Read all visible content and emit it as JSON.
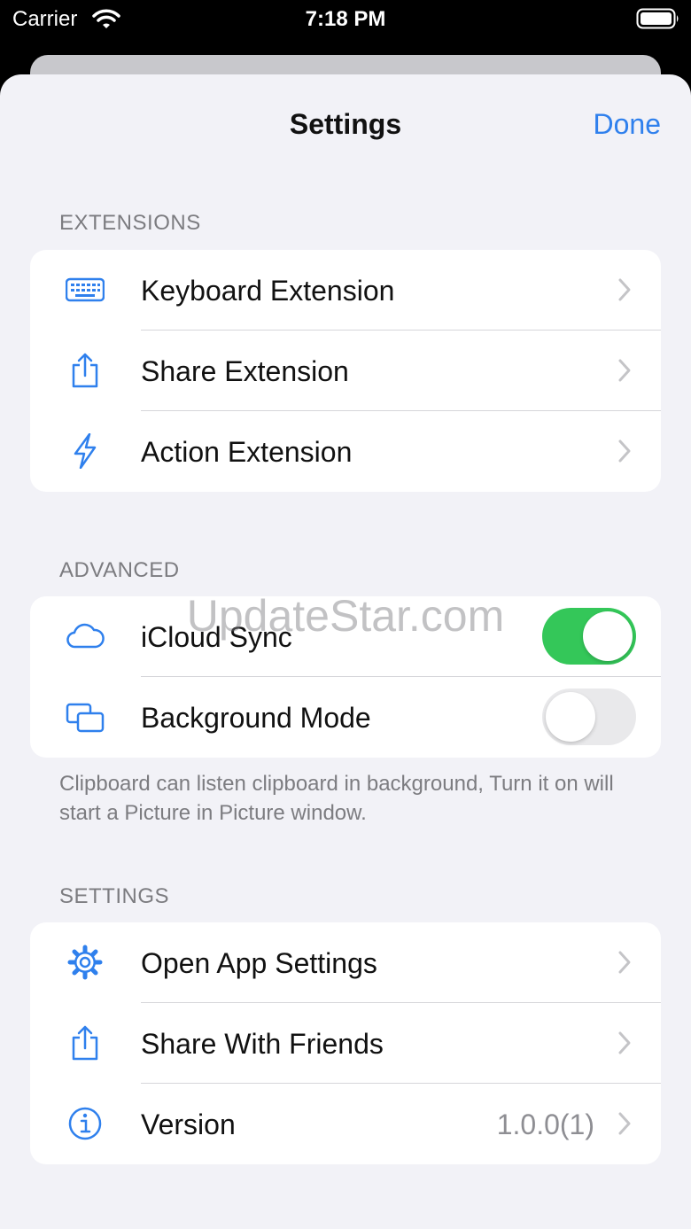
{
  "status_bar": {
    "carrier": "Carrier",
    "time": "7:18 PM"
  },
  "nav": {
    "title": "Settings",
    "done_label": "Done"
  },
  "sections": {
    "extensions": {
      "header": "EXTENSIONS",
      "items": [
        {
          "label": "Keyboard Extension",
          "icon": "keyboard-icon"
        },
        {
          "label": "Share Extension",
          "icon": "share-icon"
        },
        {
          "label": "Action Extension",
          "icon": "bolt-icon"
        }
      ]
    },
    "advanced": {
      "header": "ADVANCED",
      "items": [
        {
          "label": "iCloud Sync",
          "icon": "cloud-icon",
          "toggle": true
        },
        {
          "label": "Background Mode",
          "icon": "windows-icon",
          "toggle": false
        }
      ],
      "footer": "Clipboard can listen clipboard in background, Turn it on will start a Picture in Picture window."
    },
    "settings": {
      "header": "SETTINGS",
      "items": [
        {
          "label": "Open App Settings",
          "icon": "gear-icon"
        },
        {
          "label": "Share With Friends",
          "icon": "share-icon"
        },
        {
          "label": "Version",
          "icon": "info-icon",
          "value": "1.0.0(1)"
        }
      ]
    }
  },
  "watermark": "UpdateStar.com",
  "colors": {
    "accent": "#2f80ed",
    "toggle_on": "#34c759",
    "background": "#f2f2f7"
  }
}
